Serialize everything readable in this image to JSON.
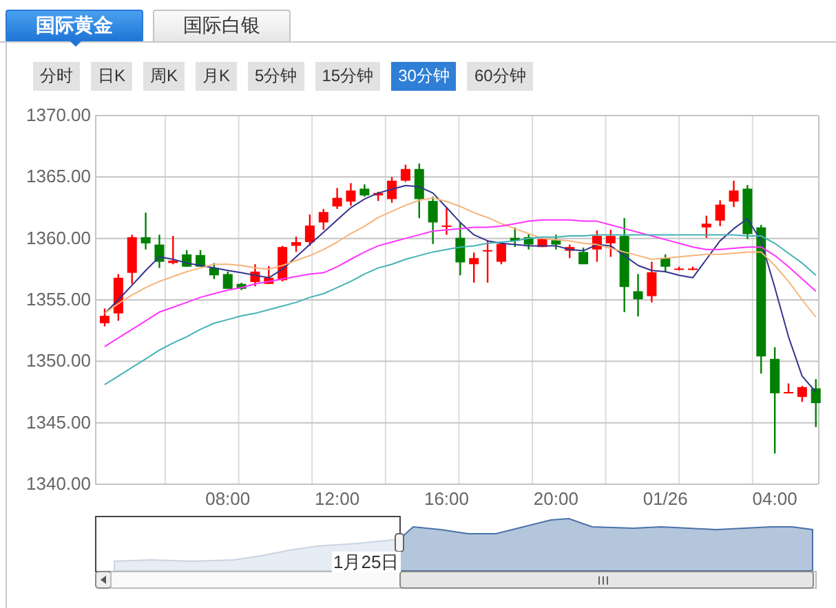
{
  "tabs": [
    {
      "label": "国际黄金",
      "selected": true
    },
    {
      "label": "国际白银",
      "selected": false
    }
  ],
  "periods": [
    {
      "label": "分时",
      "selected": false
    },
    {
      "label": "日K",
      "selected": false
    },
    {
      "label": "周K",
      "selected": false
    },
    {
      "label": "月K",
      "selected": false
    },
    {
      "label": "5分钟",
      "selected": false
    },
    {
      "label": "15分钟",
      "selected": false
    },
    {
      "label": "30分钟",
      "selected": true
    },
    {
      "label": "60分钟",
      "selected": false
    }
  ],
  "chart": {
    "chart_data": {
      "type": "candlestick",
      "grid": true,
      "ylim": [
        1340,
        1370
      ],
      "yticks": [
        {
          "value": 1340,
          "label": "1340.00"
        },
        {
          "value": 1345,
          "label": "1345.00"
        },
        {
          "value": 1350,
          "label": "1350.00"
        },
        {
          "value": 1355,
          "label": "1355.00"
        },
        {
          "value": 1360,
          "label": "1360.00"
        },
        {
          "value": 1365,
          "label": "1365.00"
        },
        {
          "value": 1370,
          "label": "1370.00"
        }
      ],
      "categories": [
        null,
        null,
        null,
        null,
        null,
        null,
        null,
        null,
        null,
        "08:00",
        null,
        null,
        null,
        null,
        null,
        null,
        null,
        "12:00",
        null,
        null,
        null,
        null,
        null,
        null,
        null,
        "16:00",
        null,
        null,
        null,
        null,
        null,
        null,
        null,
        "20:00",
        null,
        null,
        null,
        null,
        null,
        null,
        null,
        "01/26",
        null,
        null,
        null,
        null,
        null,
        null,
        null,
        "04:00",
        null,
        null,
        null
      ],
      "ohlc": [
        [
          1353.1,
          1354.3,
          1352.85,
          1353.7
        ],
        [
          1353.9,
          1357.1,
          1353.3,
          1356.8
        ],
        [
          1357.2,
          1360.3,
          1356.3,
          1360.1
        ],
        [
          1360.1,
          1362.1,
          1359.1,
          1359.6
        ],
        [
          1359.5,
          1360.3,
          1357.6,
          1358.1
        ],
        [
          1358.0,
          1360.2,
          1357.9,
          1358.2
        ],
        [
          1358.7,
          1359.05,
          1357.7,
          1357.7
        ],
        [
          1358.65,
          1359.05,
          1357.7,
          1357.7
        ],
        [
          1357.6,
          1358.0,
          1356.7,
          1357.0
        ],
        [
          1357.1,
          1357.3,
          1355.9,
          1355.9
        ],
        [
          1356.3,
          1356.4,
          1355.8,
          1355.9
        ],
        [
          1356.45,
          1357.9,
          1356.1,
          1357.3
        ],
        [
          1356.3,
          1357.75,
          1356.3,
          1356.8
        ],
        [
          1356.6,
          1359.4,
          1356.5,
          1359.3
        ],
        [
          1359.4,
          1360.15,
          1358.9,
          1359.7
        ],
        [
          1359.7,
          1361.95,
          1359.4,
          1361.05
        ],
        [
          1361.3,
          1362.4,
          1360.7,
          1362.15
        ],
        [
          1362.6,
          1364.1,
          1362.4,
          1363.3
        ],
        [
          1363.0,
          1364.5,
          1362.65,
          1363.9
        ],
        [
          1364.05,
          1364.4,
          1363.4,
          1363.5
        ],
        [
          1363.5,
          1363.8,
          1363.05,
          1363.7
        ],
        [
          1363.2,
          1365.0,
          1362.9,
          1364.7
        ],
        [
          1364.7,
          1366.0,
          1364.6,
          1365.65
        ],
        [
          1365.65,
          1366.1,
          1361.65,
          1363.2
        ],
        [
          1363.05,
          1363.4,
          1359.55,
          1361.3
        ],
        [
          1361.0,
          1362.55,
          1360.3,
          1361.05
        ],
        [
          1360.05,
          1361.3,
          1357.0,
          1358.05
        ],
        [
          1357.9,
          1358.85,
          1356.4,
          1358.4
        ],
        [
          1359.0,
          1359.85,
          1356.4,
          1359.05
        ],
        [
          1358.1,
          1359.7,
          1357.9,
          1359.55
        ],
        [
          1360.05,
          1360.9,
          1359.3,
          1359.8
        ],
        [
          1360.1,
          1360.35,
          1359.1,
          1359.5
        ],
        [
          1359.3,
          1360.05,
          1359.3,
          1359.95
        ],
        [
          1359.85,
          1360.3,
          1359.1,
          1359.5
        ],
        [
          1359.0,
          1359.5,
          1358.4,
          1359.3
        ],
        [
          1358.9,
          1359.25,
          1357.9,
          1357.9
        ],
        [
          1359.1,
          1360.65,
          1358.1,
          1360.2
        ],
        [
          1359.6,
          1360.7,
          1358.5,
          1360.2
        ],
        [
          1360.2,
          1361.65,
          1354.0,
          1356.05
        ],
        [
          1355.7,
          1357.1,
          1353.65,
          1355.05
        ],
        [
          1355.3,
          1358.1,
          1354.8,
          1357.25
        ],
        [
          1358.4,
          1358.7,
          1357.3,
          1357.7
        ],
        [
          1357.55,
          1357.7,
          1357.4,
          1357.55
        ],
        [
          1357.55,
          1357.7,
          1357.4,
          1357.55
        ],
        [
          1360.9,
          1361.85,
          1360.05,
          1361.2
        ],
        [
          1361.45,
          1363.1,
          1361.0,
          1362.75
        ],
        [
          1363.0,
          1364.7,
          1362.55,
          1363.9
        ],
        [
          1364.05,
          1364.35,
          1359.95,
          1360.35
        ],
        [
          1360.9,
          1361.1,
          1349.0,
          1350.4
        ],
        [
          1350.2,
          1351.15,
          1342.5,
          1347.4
        ],
        [
          1347.5,
          1348.2,
          1347.4,
          1347.5
        ],
        [
          1347.1,
          1348.0,
          1346.7,
          1347.9
        ],
        [
          1347.8,
          1348.55,
          1344.65,
          1346.6
        ]
      ],
      "series": [
        {
          "type": "line",
          "color": "#33338f",
          "values": [
            1353.9,
            1355.0,
            1356.2,
            1357.4,
            1358.5,
            1358.3,
            1358.0,
            1357.8,
            1357.6,
            1357.4,
            1357.2,
            1357.0,
            1356.8,
            1357.5,
            1358.5,
            1359.5,
            1360.5,
            1361.5,
            1362.5,
            1363.2,
            1363.7,
            1364.0,
            1364.3,
            1364.2,
            1363.7,
            1362.5,
            1361.3,
            1360.3,
            1359.8,
            1359.6,
            1359.5,
            1359.4,
            1359.4,
            1359.4,
            1359.1,
            1359.0,
            1359.5,
            1359.4,
            1358.6,
            1357.8,
            1357.4,
            1357.3,
            1357.0,
            1356.8,
            1358.3,
            1359.8,
            1360.8,
            1361.6,
            1359.8,
            1356.0,
            1352.0,
            1348.8,
            1347.5
          ]
        },
        {
          "type": "line",
          "color": "#f5b47a",
          "values": [
            1353.9,
            1354.7,
            1355.4,
            1356.0,
            1356.5,
            1356.9,
            1357.3,
            1357.6,
            1357.9,
            1357.9,
            1357.8,
            1357.6,
            1357.5,
            1357.8,
            1358.2,
            1358.6,
            1359.1,
            1359.7,
            1360.4,
            1361.0,
            1361.7,
            1362.2,
            1362.7,
            1363.1,
            1363.3,
            1363.0,
            1362.6,
            1362.1,
            1361.7,
            1361.2,
            1360.8,
            1360.4,
            1360.0,
            1359.9,
            1359.8,
            1359.6,
            1359.5,
            1359.2,
            1358.9,
            1358.6,
            1358.3,
            1358.4,
            1358.5,
            1358.6,
            1358.7,
            1358.7,
            1358.8,
            1358.9,
            1358.9,
            1357.8,
            1356.5,
            1355.0,
            1353.6
          ]
        },
        {
          "type": "line",
          "color": "#ff33ff",
          "values": [
            1351.2,
            1351.9,
            1352.6,
            1353.3,
            1354.0,
            1354.4,
            1354.8,
            1355.2,
            1355.5,
            1355.8,
            1356.0,
            1356.3,
            1356.5,
            1356.7,
            1356.9,
            1357.1,
            1357.2,
            1357.7,
            1358.3,
            1358.9,
            1359.4,
            1359.7,
            1360.0,
            1360.3,
            1360.6,
            1360.7,
            1360.8,
            1360.9,
            1360.9,
            1361.0,
            1361.2,
            1361.4,
            1361.5,
            1361.5,
            1361.5,
            1361.4,
            1361.4,
            1361.1,
            1360.8,
            1360.5,
            1360.2,
            1359.9,
            1359.6,
            1359.3,
            1359.1,
            1359.1,
            1359.2,
            1359.3,
            1359.3,
            1358.6,
            1357.7,
            1356.7,
            1355.7
          ]
        },
        {
          "type": "line",
          "color": "#44b2b6",
          "values": [
            1348.1,
            1348.8,
            1349.5,
            1350.2,
            1350.9,
            1351.5,
            1352.0,
            1352.6,
            1353.1,
            1353.4,
            1353.7,
            1353.9,
            1354.2,
            1354.5,
            1354.8,
            1355.2,
            1355.5,
            1356.0,
            1356.5,
            1357.1,
            1357.6,
            1357.9,
            1358.3,
            1358.6,
            1358.9,
            1359.1,
            1359.3,
            1359.4,
            1359.6,
            1359.7,
            1359.8,
            1360.0,
            1360.1,
            1360.1,
            1360.2,
            1360.2,
            1360.3,
            1360.3,
            1360.3,
            1360.3,
            1360.3,
            1360.3,
            1360.3,
            1360.3,
            1360.3,
            1360.3,
            1360.3,
            1360.2,
            1360.2,
            1359.6,
            1358.8,
            1358.0,
            1357.0
          ]
        }
      ]
    }
  },
  "navigator": {
    "date_label": "1月25日"
  }
}
